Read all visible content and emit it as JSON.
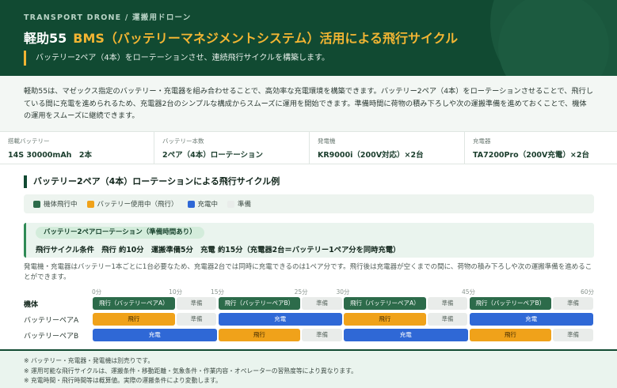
{
  "header": {
    "eyebrow": "TRANSPORT DRONE / 運搬用ドローン",
    "title_model": "軽助55",
    "title_main": "BMS（バッテリーマネジメントシステム）活用による飛行サイクル",
    "subtitle": "バッテリー2ペア（4本）をローテーションさせ、連続飛行サイクルを構築します。"
  },
  "intro": {
    "text": "軽助55は、マゼックス指定のバッテリー・充電器を組み合わせることで、高効率な充電環境を構築できます。バッテリー2ペア（4本）をローテーションさせることで、飛行している間に充電を進められるため、充電器2台のシンプルな構成からスムーズに運用を開始できます。準備時間に荷物の積み下ろしや次の運搬準備を進めておくことで、機体の運用をスムーズに継続できます。"
  },
  "specs": [
    {
      "label": "搭載バッテリー",
      "value": "14S 30000mAh　2本"
    },
    {
      "label": "バッテリー本数",
      "value": "2ペア（4本）ローテーション"
    },
    {
      "label": "発電機",
      "value": "KR9000i（200V対応）×2台"
    },
    {
      "label": "充電器",
      "value": "TA7200Pro（200V充電）×2台"
    }
  ],
  "section": {
    "title": "バッテリー2ペア（4本）ローテーションによる飛行サイクル例"
  },
  "legend": [
    {
      "label": "機体飛行中",
      "color": "#2c6b4a"
    },
    {
      "label": "バッテリー使用中（飛行）",
      "color": "#f0a21a"
    },
    {
      "label": "充電中",
      "color": "#2f68d6"
    },
    {
      "label": "準備",
      "color": "#e9ecea"
    }
  ],
  "condition": {
    "tag": "バッテリー2ペアローテーション（準備時間あり）",
    "line": "飛行サイクル条件　飛行 約10分　運搬準備5分　充電 約15分（充電器2台＝バッテリー1ペア分を同時充電）"
  },
  "note": "発電機・充電器はバッテリー1本ごとに1台必要なため、充電器2台では同時に充電できるのは1ペア分です。飛行後は充電器が空くまでの間に、荷物の積み下ろしや次の運搬準備を進めることができます。",
  "timeline": {
    "max_minutes": 60,
    "ticks": [
      "0分",
      "10分",
      "15分",
      "25分",
      "30分",
      "45分",
      "60分"
    ],
    "tick_minutes": [
      0,
      10,
      15,
      25,
      30,
      45,
      60
    ],
    "rows": [
      {
        "label": "機体",
        "segments": [
          {
            "kind": "fly",
            "start": 0,
            "end": 10,
            "text": "飛行（バッテリーペアA）"
          },
          {
            "kind": "prep",
            "start": 10,
            "end": 15,
            "text": "準備"
          },
          {
            "kind": "fly",
            "start": 15,
            "end": 25,
            "text": "飛行（バッテリーペアB）"
          },
          {
            "kind": "prep",
            "start": 25,
            "end": 30,
            "text": "準備"
          },
          {
            "kind": "fly",
            "start": 30,
            "end": 40,
            "text": "飛行（バッテリーペアA）"
          },
          {
            "kind": "prep",
            "start": 40,
            "end": 45,
            "text": "準備"
          },
          {
            "kind": "fly",
            "start": 45,
            "end": 55,
            "text": "飛行（バッテリーペアB）"
          },
          {
            "kind": "prep",
            "start": 55,
            "end": 60,
            "text": "準備"
          }
        ]
      },
      {
        "label": "バッテリーペアA",
        "segments": [
          {
            "kind": "use",
            "start": 0,
            "end": 10,
            "text": "飛行"
          },
          {
            "kind": "prep",
            "start": 10,
            "end": 15,
            "text": "準備"
          },
          {
            "kind": "chg",
            "start": 15,
            "end": 30,
            "text": "充電"
          },
          {
            "kind": "use",
            "start": 30,
            "end": 40,
            "text": "飛行"
          },
          {
            "kind": "prep",
            "start": 40,
            "end": 45,
            "text": "準備"
          },
          {
            "kind": "chg",
            "start": 45,
            "end": 60,
            "text": "充電"
          }
        ]
      },
      {
        "label": "バッテリーペアB",
        "segments": [
          {
            "kind": "chg",
            "start": 0,
            "end": 15,
            "text": "充電"
          },
          {
            "kind": "use",
            "start": 15,
            "end": 25,
            "text": "飛行"
          },
          {
            "kind": "prep",
            "start": 25,
            "end": 30,
            "text": "準備"
          },
          {
            "kind": "chg",
            "start": 30,
            "end": 45,
            "text": "充電"
          },
          {
            "kind": "use",
            "start": 45,
            "end": 55,
            "text": "飛行"
          },
          {
            "kind": "prep",
            "start": 55,
            "end": 60,
            "text": "準備"
          }
        ]
      }
    ]
  },
  "footnotes": [
    "※ バッテリー・充電器・発電機は別売りです。",
    "※ 運用可能な飛行サイクルは、運搬条件・移動距離・気象条件・作業内容・オペレーターの習熟度等により異なります。",
    "※ 充電時間・飛行時間等は概算値。実際の運搬条件により変動します。"
  ]
}
